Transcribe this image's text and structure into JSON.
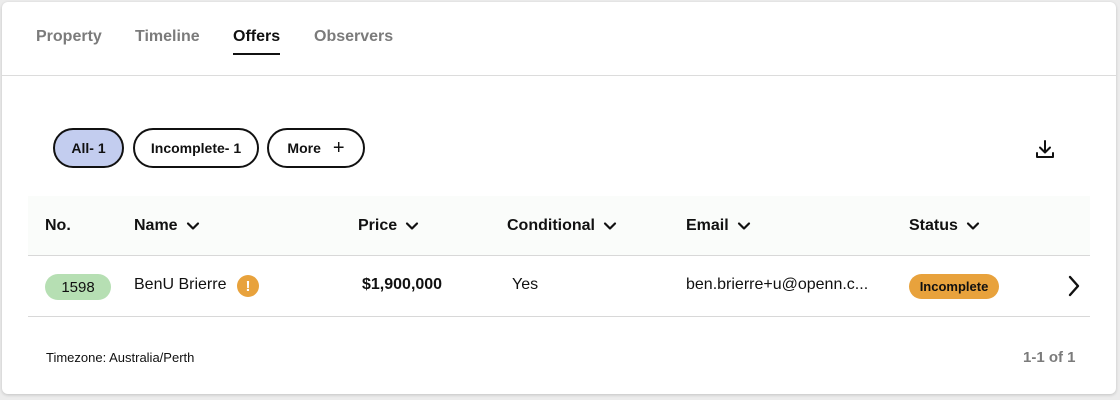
{
  "tabs": [
    {
      "label": "Property"
    },
    {
      "label": "Timeline"
    },
    {
      "label": "Offers"
    },
    {
      "label": "Observers"
    }
  ],
  "active_tab": "Offers",
  "filters": {
    "all_label": "All- 1",
    "incomplete_label": "Incomplete- 1",
    "more_label": "More",
    "more_icon": "plus-icon"
  },
  "toolbar": {
    "download_icon": "download-icon"
  },
  "table": {
    "columns": [
      "No.",
      "Name",
      "Price",
      "Conditional",
      "Email",
      "Status"
    ],
    "rows": [
      {
        "no": "1598",
        "name": "BenU Brierre",
        "warning_icon": "exclamation-icon",
        "price": "$1,900,000",
        "conditional": "Yes",
        "email": "ben.brierre+u@openn.c...",
        "status": "Incomplete"
      }
    ]
  },
  "footer": {
    "timezone": "Timezone: Australia/Perth",
    "pagination": "1-1 of 1"
  },
  "colors": {
    "active_pill": "#c3cdef",
    "number_badge": "#b6dfb3",
    "status_incomplete": "#e8a23c",
    "warning": "#e8a23c"
  }
}
